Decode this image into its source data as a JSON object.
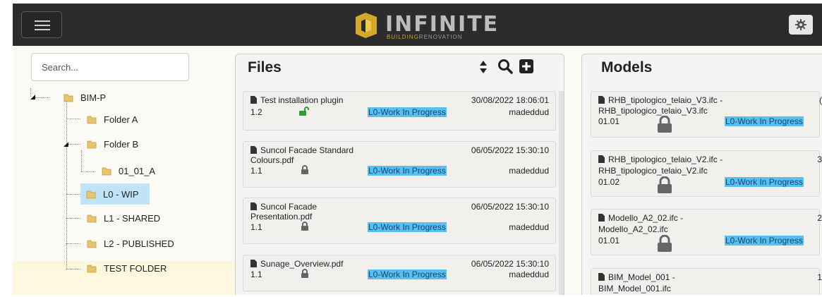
{
  "header": {
    "logo_text": "INFINITE",
    "logo_sub_a": "BUILDING",
    "logo_sub_b": "RENOVATION"
  },
  "search": {
    "placeholder": "Search..."
  },
  "tree": {
    "root": "BIM-P",
    "items": [
      "Folder A",
      "Folder B",
      "01_01_A",
      "L0 - WIP",
      "L1 - SHARED",
      "L2 - PUBLISHED",
      "TEST FOLDER"
    ],
    "selected": "L0 - WIP"
  },
  "files": {
    "title": "Files",
    "items": [
      {
        "name": "Test installation plugin",
        "version": "1.2",
        "date": "30/08/2022 18:06:01",
        "status": "L0-Work In Progress",
        "user": "madeddud",
        "lock": "unlocked"
      },
      {
        "name": "Suncol Facade Standard",
        "name2": "Colours.pdf",
        "version": "1.1",
        "date": "06/05/2022 15:30:10",
        "status": "L0-Work In Progress",
        "user": "madeddud",
        "lock": "locked"
      },
      {
        "name": "Suncol Facade",
        "name2": "Presentation.pdf",
        "version": "1.1",
        "date": "06/05/2022 15:30:10",
        "status": "L0-Work In Progress",
        "user": "madeddud",
        "lock": "locked"
      },
      {
        "name": "Sunage_Overview.pdf",
        "version": "1.1",
        "date": "06/05/2022 15:30:10",
        "status": "L0-Work In Progress",
        "user": "madeddud",
        "lock": "locked"
      }
    ]
  },
  "models": {
    "title": "Models",
    "items": [
      {
        "line1": "RHB_tipologico_telaio_V3.ifc -",
        "line2": "RHB_tipologico_telaio_V3.ifc",
        "version": "01.01",
        "status": "L0-Work In Progress",
        "side": "("
      },
      {
        "line1": "RHB_tipologico_telaio_V2.ifc -",
        "line2": "RHB_tipologico_telaio_V2.ifc",
        "version": "01.02",
        "status": "L0-Work In Progress",
        "side": "3"
      },
      {
        "line1": "Modello_A2_02.ifc -",
        "line2": "Modello_A2_02.ifc",
        "version": "01.01",
        "status": "L0-Work In Progress",
        "side": "2"
      },
      {
        "line1": "BIM_Model_001 -",
        "line2": "BIM_Model_001.ifc",
        "side": "1"
      }
    ]
  },
  "colors": {
    "topbar": "#2c2c2c",
    "status_bg": "#57c0f0",
    "unlock": "#2e9e2e",
    "logo_accent": "#c9a227"
  },
  "icons": [
    "menu-icon",
    "gear-icon",
    "folder-icon",
    "sort-icon",
    "search-icon",
    "add-icon",
    "file-icon",
    "lock-icon",
    "unlock-icon"
  ]
}
